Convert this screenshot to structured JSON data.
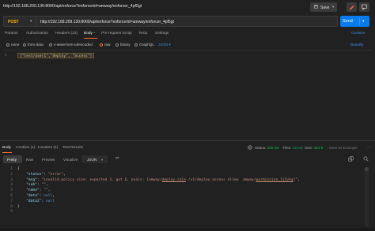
{
  "header": {
    "request_title": "http://192.168.209.130:8000/api/enforce?enforcerid=amway/enforcer_4pf5gt",
    "save_label": "Save",
    "save_icon": "save-icon",
    "edit_icon": "pencil-icon",
    "comment_icon": "comment-icon"
  },
  "request": {
    "method": "POST",
    "method_color": "#ffb400",
    "url": "http://192.168.209.130:8000/api/enforce?enforcerid=amway/enforcer_4pf5gt",
    "send_label": "Send",
    "send_color": "#097bed"
  },
  "request_tabs": {
    "params": "Params",
    "authorization": "Authorization",
    "headers": "Headers (10)",
    "body": "Body",
    "pre_request": "Pre-request Script",
    "tests": "Tests",
    "settings": "Settings",
    "cookies": "Cookies",
    "accent_color": "#ff6c37"
  },
  "body_types": {
    "none": "none",
    "form_data": "form-data",
    "urlencoded": "x-www-form-urlencoded",
    "raw": "raw",
    "binary": "binary",
    "graphql": "GraphQL",
    "format": "JSON",
    "beautify": "Beautify",
    "selected": "raw"
  },
  "request_body": {
    "line_number": "1",
    "content": "[\"test/user1\",\"deploy\", \"access\"]"
  },
  "response_tabs": {
    "body": "Body",
    "cookies": "Cookies (1)",
    "headers": "Headers (4)",
    "test_results": "Test Results"
  },
  "response_meta": {
    "status_label": "Status:",
    "status_value": "200 OK",
    "time_label": "Time:",
    "time_value": "13 ms",
    "size_label": "Size:",
    "size_value": "363 B",
    "save_example": "Save as Example",
    "success_color": "#0cbb52"
  },
  "response_view": {
    "pretty": "Pretty",
    "raw": "Raw",
    "preview": "Preview",
    "visualize": "Visualize",
    "format": "JSON"
  },
  "response_body": {
    "line_numbers": [
      "1",
      "2",
      "3",
      "4",
      "5",
      "6",
      "7",
      "8",
      "9"
    ],
    "status_key": "\"status\"",
    "status_val": "\"error\"",
    "msg_key": "\"msg\"",
    "msg_val_pre": "\"invalid policy size: expected 3, got 6, pvals: [amway/",
    "msg_val_link1": "deploy-role",
    "msg_val_mid": " /v1/deploy access allow  amway/",
    "msg_val_link2": "permission_1j2vhq",
    "msg_val_post": "]\"",
    "sub_key": "\"sub\"",
    "sub_val": "\"\"",
    "name_key": "\"name\"",
    "name_val": "\"\"",
    "data_key": "\"data\"",
    "data_val": "null",
    "data2_key": "\"data2\"",
    "data2_val": "null",
    "open_brace": "{",
    "close_brace": "}"
  }
}
